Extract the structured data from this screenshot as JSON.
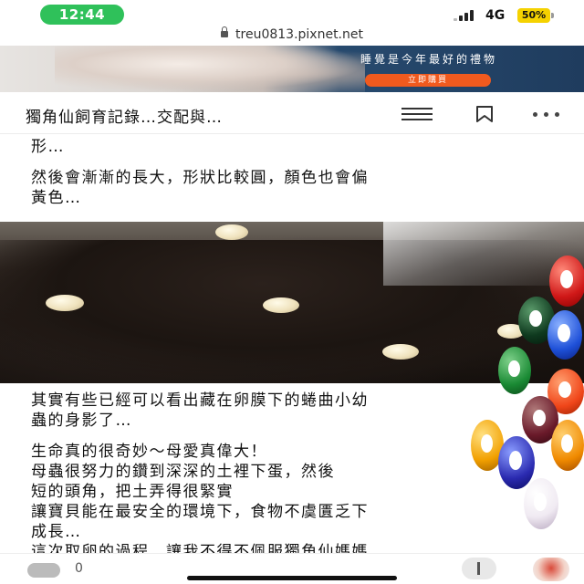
{
  "status_bar": {
    "time": "12:44",
    "network": "4G",
    "battery": "50%"
  },
  "browser": {
    "url": "treu0813.pixnet.net"
  },
  "ad": {
    "headline": "睡覺是今年最好的禮物",
    "button_label": "立即購買"
  },
  "header": {
    "title": "獨角仙飼育記錄…交配與…",
    "icons": [
      "menu-icon",
      "bookmark-icon",
      "more-icon"
    ]
  },
  "article": {
    "para1": "形…",
    "para2": "然後會漸漸的長大，形狀比較圓，顏色也會偏\n黃色…",
    "para3": "其實有些已經可以看出藏在卵膜下的蜷曲小幼\n蟲的身影了…",
    "para4": "生命真的很奇妙～母愛真偉大！\n母蟲很努力的鑽到深深的土裡下蛋，然後\n短的頭角，把土弄得很緊實\n讓寶貝能在最安全的環境下，食物不虞匱乏下\n成長…",
    "para5": "這次取卵的過程，讓我不得不佩服獨角仙媽媽"
  },
  "bottom_bar": {
    "like_count": "0"
  },
  "colors": {
    "status_pill": "#2fc15a",
    "battery": "#f5d200",
    "ad_button": "#f05a1e",
    "ad_bg": "#1f3c5e"
  }
}
